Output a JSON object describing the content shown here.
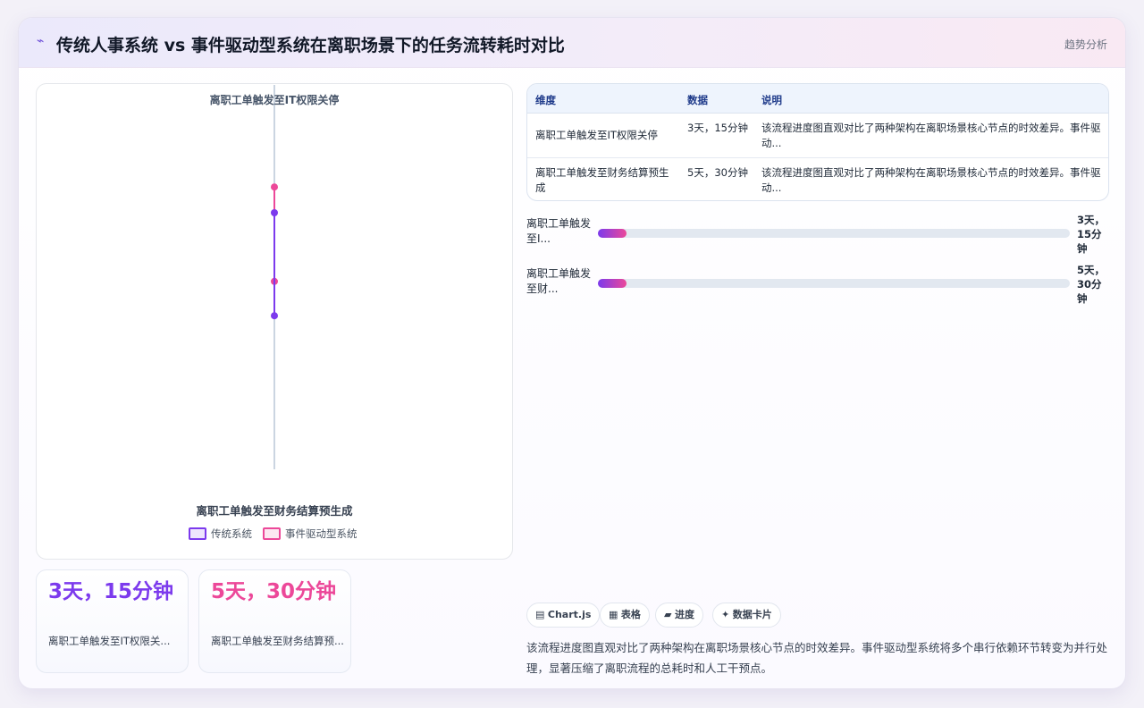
{
  "header": {
    "icon": "trend-line-icon",
    "title": "传统人事系统 vs 事件驱动型系统在离职场景下的任务流转耗时对比",
    "tag": "趋势分析"
  },
  "chart_data": {
    "type": "line",
    "categories": [
      "离职工单触发至IT权限关停",
      "离职工单触发至财务结算预生成"
    ],
    "series": [
      {
        "name": "传统系统",
        "color": "#7c3aed",
        "values": [
          0.75,
          0.45
        ]
      },
      {
        "name": "事件驱动型系统",
        "color": "#ec4899",
        "values": [
          1.05,
          0.05
        ]
      }
    ],
    "legend_position": "bottom"
  },
  "stats": [
    {
      "value": "3天，15分钟",
      "label": "离职工单触发至IT权限关...",
      "color": "#7c3aed"
    },
    {
      "value": "5天，30分钟",
      "label": "离职工单触发至财务结算预...",
      "color": "#ec4899"
    }
  ],
  "table": {
    "headers": [
      "维度",
      "数据",
      "说明"
    ],
    "rows": [
      {
        "dim": "离职工单触发至IT权限关停",
        "data": "3天，15分钟",
        "desc": "该流程进度图直观对比了两种架构在离职场景核心节点的时效差异。事件驱动..."
      },
      {
        "dim": "离职工单触发至财务结算预生成",
        "data": "5天，30分钟",
        "desc": "该流程进度图直观对比了两种架构在离职场景核心节点的时效差异。事件驱动..."
      }
    ]
  },
  "progress": [
    {
      "label": "离职工单触发至I...",
      "value": "3天，15分钟",
      "fraction": 0.06
    },
    {
      "label": "离职工单触发至财...",
      "value": "5天，30分钟",
      "fraction": 0.06
    }
  ],
  "chips": [
    {
      "icon": "chart-icon",
      "glyph": "▤",
      "label": "Chart.js"
    },
    {
      "icon": "table-icon",
      "glyph": "▦",
      "label": "表格"
    },
    {
      "icon": "progress-icon",
      "glyph": "▰",
      "label": "进度"
    },
    {
      "icon": "sparkle-icon",
      "glyph": "✦",
      "label": "数据卡片"
    }
  ],
  "description": "该流程进度图直观对比了两种架构在离职场景核心节点的时效差异。事件驱动型系统将多个串行依赖环节转变为并行处理，显著压缩了离职流程的总耗时和人工干预点。"
}
